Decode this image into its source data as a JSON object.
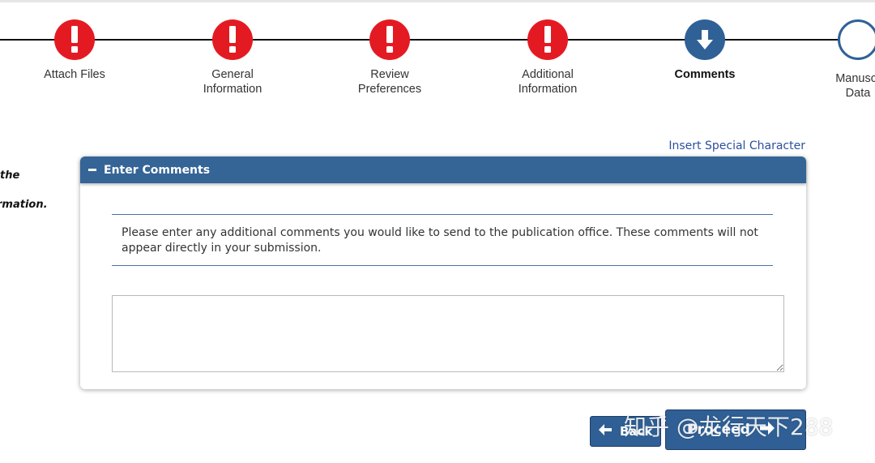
{
  "steps": [
    {
      "label": "Attach Files",
      "status": "error",
      "icon": "exclamation-icon"
    },
    {
      "label": "General\nInformation",
      "status": "error",
      "icon": "exclamation-icon"
    },
    {
      "label": "Review\nPreferences",
      "status": "error",
      "icon": "exclamation-icon"
    },
    {
      "label": "Additional\nInformation",
      "status": "error",
      "icon": "exclamation-icon"
    },
    {
      "label": "Comments",
      "status": "current",
      "icon": "arrow-down-icon"
    },
    {
      "label": "Manuscr\nData",
      "status": "incomplete",
      "icon": "empty-circle-icon"
    }
  ],
  "side_note": {
    "line1": "the",
    "line2": "rmation."
  },
  "special_char_link": "Insert Special Character",
  "panel": {
    "title": "Enter Comments",
    "instructions": "Please enter any additional comments you would like to send to the publication office. These comments will not appear directly in your submission.",
    "comment_value": ""
  },
  "buttons": {
    "back": "Back",
    "proceed": "Proceed"
  },
  "watermark": "知乎 @龙行天下288",
  "colors": {
    "error": "#e41a23",
    "primary": "#2f6196",
    "link": "#2d4fa0"
  }
}
